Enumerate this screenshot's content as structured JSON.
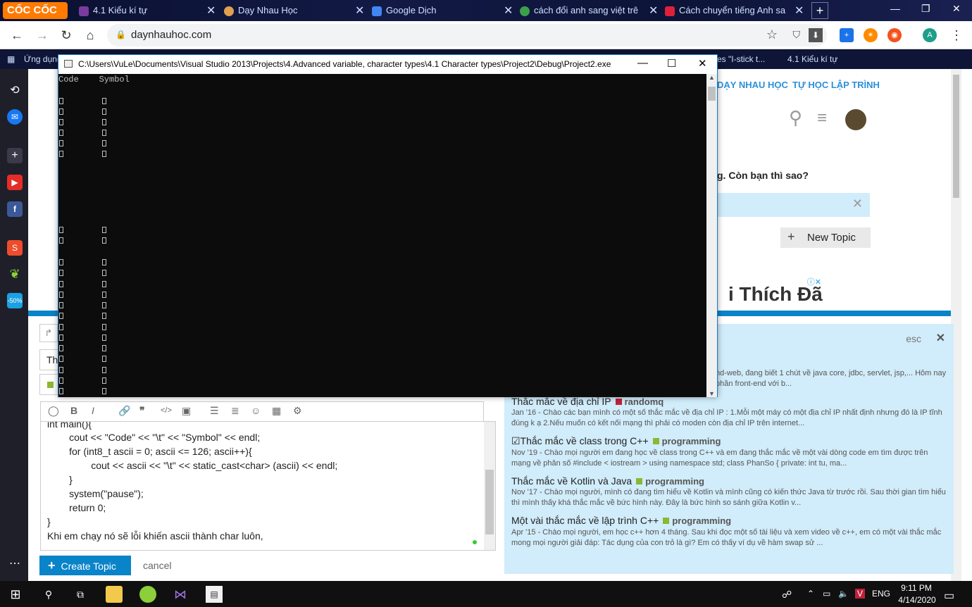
{
  "browser": {
    "brand": "CỐC CỐC",
    "tabs": [
      {
        "title": "4.1 Kiểu kí tự",
        "color": "#7a3b9e"
      },
      {
        "title": "Dạy Nhau Học",
        "color": "#e0a050"
      },
      {
        "title": "Google Dịch",
        "color": "#4285f4"
      },
      {
        "title": "cách đổi anh sang việt trê",
        "color": "#3aa14a"
      },
      {
        "title": "Cách chuyển tiếng Anh sa",
        "color": "#e0203a"
      }
    ],
    "url": "daynhauhoc.com",
    "bookmarks": [
      {
        "label": "Ứng dụng"
      },
      {
        "label": "es \"I-stick t..."
      },
      {
        "label": "4.1 Kiểu kí tự"
      }
    ]
  },
  "console": {
    "title": "C:\\Users\\VuLe\\Documents\\Visual Studio 2013\\Projects\\4.Advanced variable, character types\\4.1 Character types\\Project2\\Debug\\Project2.exe",
    "header": "Code    Symbol"
  },
  "site": {
    "nav": [
      "DẠY NHAU HỌC",
      "TỰ HỌC LẬP TRÌNH"
    ],
    "question_fragment": "g. Còn bạn thì sao?",
    "new_topic": "New Topic",
    "ad_text": "i Thích Đã"
  },
  "composer": {
    "title_fragment": "Th",
    "code_lines": [
      "int main(){",
      "        cout << \"Code\" << \"\\t\" << \"Symbol\" << endl;",
      "        for (int8_t ascii = 0; ascii <= 126; ascii++){",
      "                cout << ascii << \"\\t\" << static_cast<char> (ascii) << endl;",
      "        }",
      "        system(\"pause\");",
      "        return 0;",
      "}",
      "Khi em chạy nó sẽ lỗi khiến ascii thành char luôn,"
    ],
    "create_label": "Create Topic",
    "cancel_label": "cancel"
  },
  "similar": {
    "esc": "esc",
    "partial": "nd-web, đang biết 1 chút về java core, jdbc, servlet, jsp,...  Hôm nay",
    "partial2": "phần front-end với b...",
    "topics": [
      {
        "title": "Thắc mắc về địa chỉ IP",
        "category": "randomq",
        "color": "#c0203a",
        "excerpt": "Jan '16 - Chào các bạn mình có một số thắc mắc về địa chỉ IP : 1.Mỗi một máy có một địa chỉ IP nhất định nhưng đó là IP tĩnh đúng k ạ 2.Nếu muốn có kết nối mạng thì phải có moden còn địa chỉ IP trên internet..."
      },
      {
        "title": "☑Thắc mắc về class trong C++",
        "category": "programming",
        "color": "#8ab833",
        "excerpt": "Nov '19 - Chào mọi người em đang học về class trong C++ và em đang thắc mắc về một vài dòng code em tìm được trên mạng về phân số #include < iostream > using namespace std; class PhanSo { private: int tu, ma..."
      },
      {
        "title": "Thắc mắc về Kotlin và Java",
        "category": "programming",
        "color": "#8ab833",
        "excerpt": "Nov '17 - Chào mọi người, mình có đang tìm hiểu về Kotlin và mình cũng có kiến thức Java từ trước rồi. Sau thời gian tìm hiểu thì mình thấy khá thắc mắc về bức hình này. Đây là bức hình so sánh giữa Kotlin v..."
      },
      {
        "title": "Một vài thắc mắc về lập trình C++",
        "category": "programming",
        "color": "#8ab833",
        "excerpt": "Apr '15 - Chào mọi người, em học c++ hơn 4 tháng. Sau khi đọc một số tài liệu và xem video về c++, em có một vài thắc mắc mong mọi người giải đáp: Tác dụng của con trỏ là gì? Em có thấy ví dụ về hàm swap sử ..."
      }
    ]
  },
  "taskbar": {
    "lang": "ENG",
    "time": "9:11 PM",
    "date": "4/14/2020"
  }
}
